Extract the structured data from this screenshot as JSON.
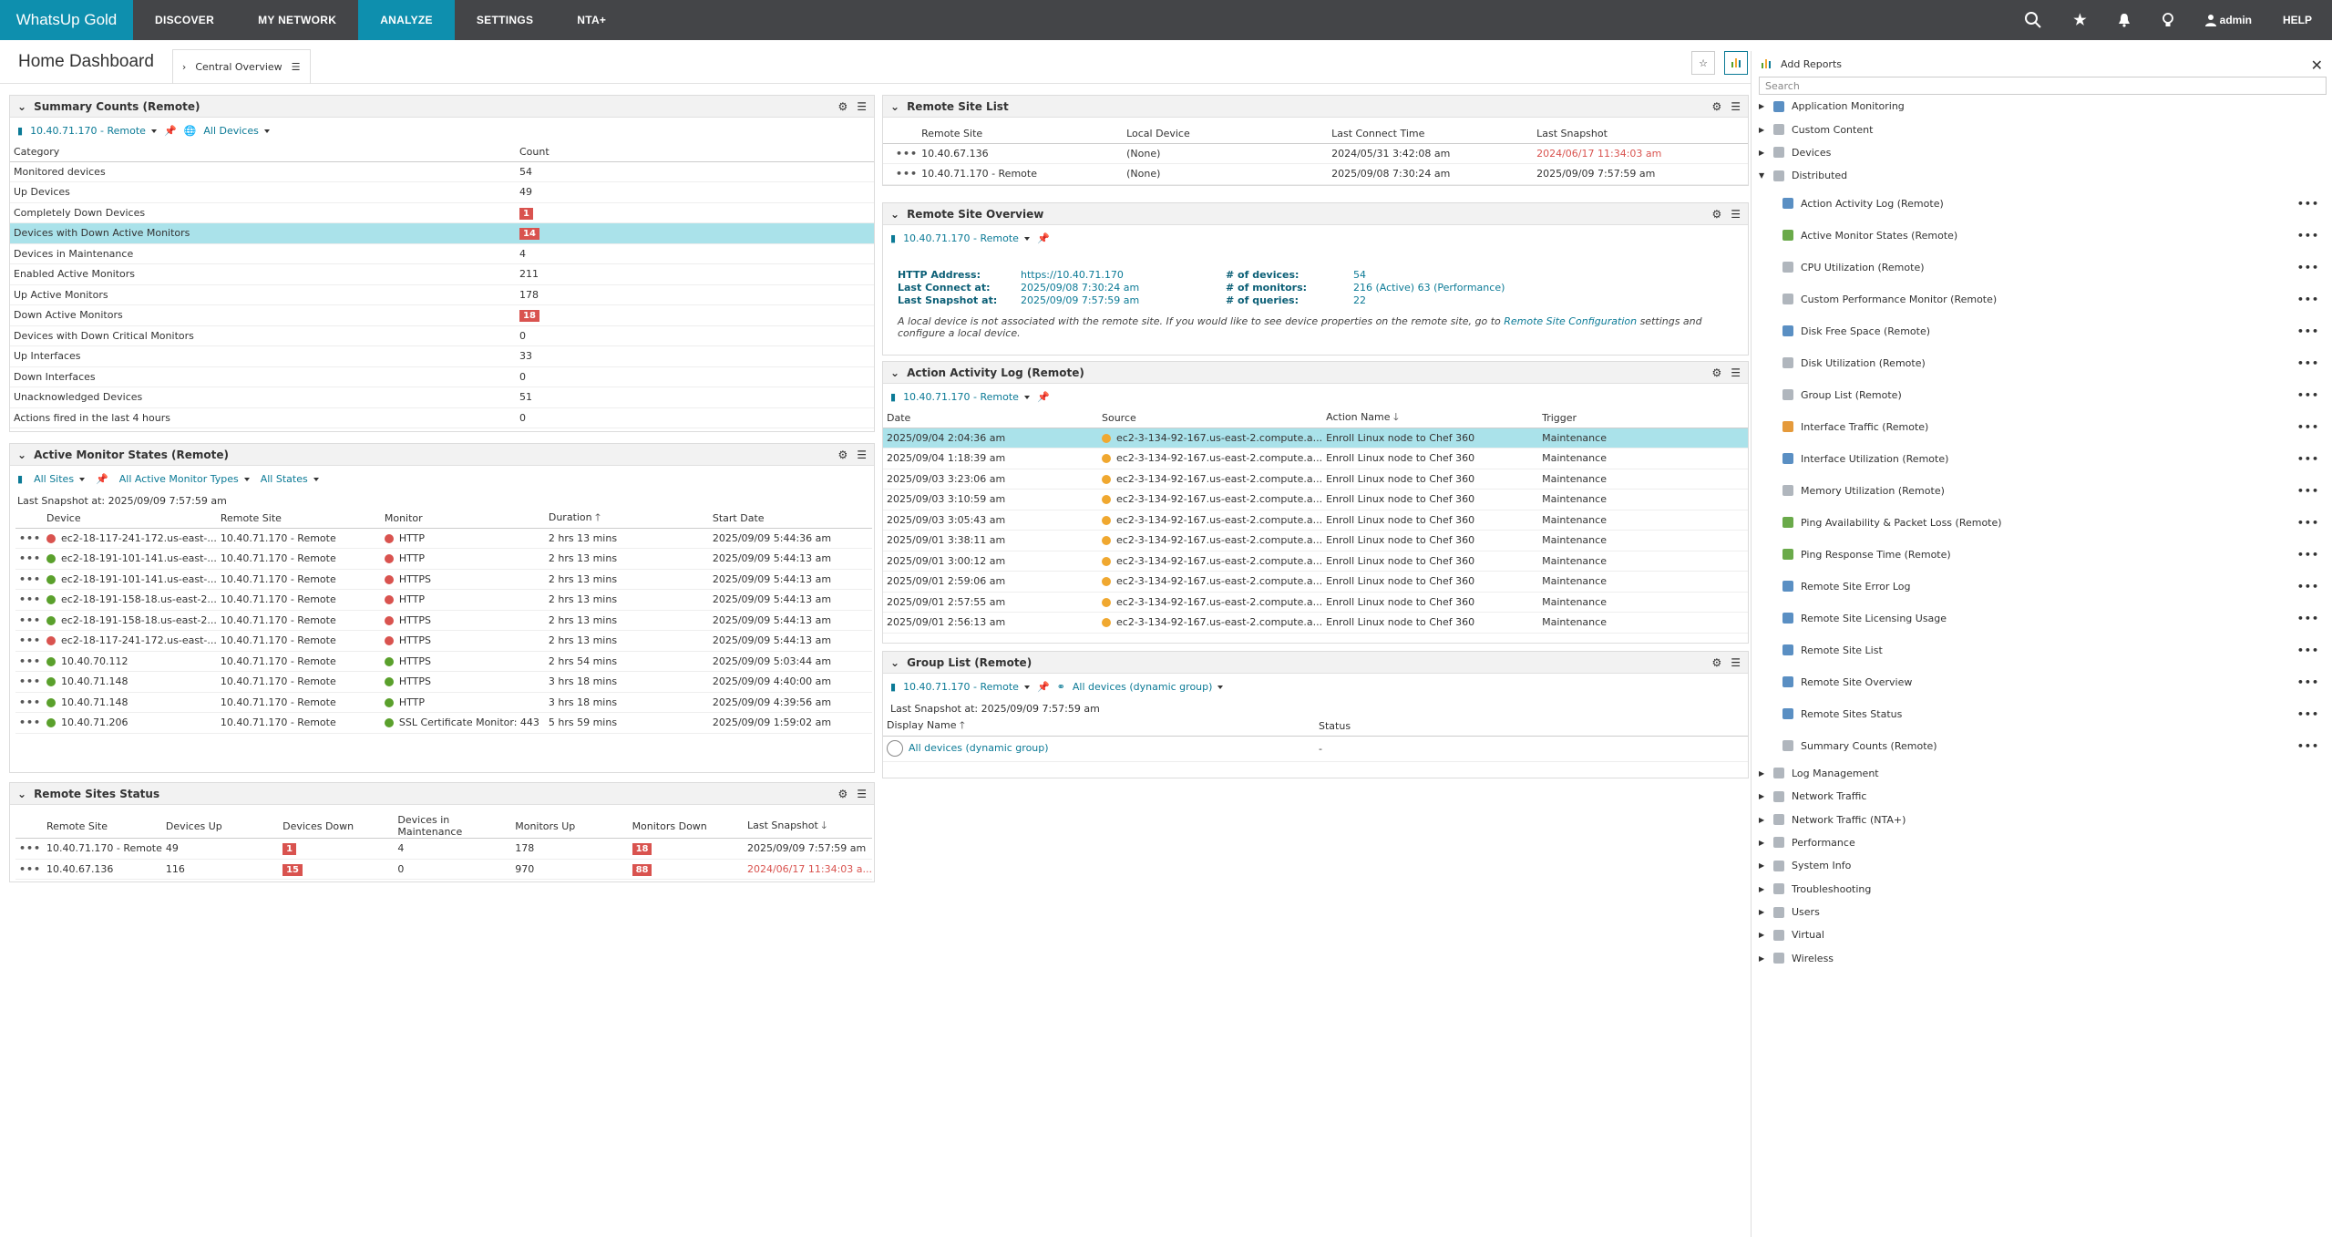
{
  "nav": {
    "logo": "WhatsUp Gold",
    "items": [
      "DISCOVER",
      "MY NETWORK",
      "ANALYZE",
      "SETTINGS",
      "NTA+"
    ],
    "active": "ANALYZE",
    "user": "admin",
    "help": "HELP"
  },
  "header": {
    "title": "Home Dashboard",
    "tab": "Central Overview"
  },
  "summary": {
    "title": "Summary Counts (Remote)",
    "site": "10.40.71.170 - Remote",
    "devices": "All Devices",
    "col_category": "Category",
    "col_count": "Count",
    "rows": [
      {
        "cat": "Monitored devices",
        "count": "54"
      },
      {
        "cat": "Up Devices",
        "count": "49"
      },
      {
        "cat": "Completely Down Devices",
        "count": "1"
      },
      {
        "cat": "Devices with Down Active Monitors",
        "count": "14"
      },
      {
        "cat": "Devices in Maintenance",
        "count": "4"
      },
      {
        "cat": "Enabled Active Monitors",
        "count": "211"
      },
      {
        "cat": "Up Active Monitors",
        "count": "178"
      },
      {
        "cat": "Down Active Monitors",
        "count": "18"
      },
      {
        "cat": "Devices with Down Critical Monitors",
        "count": "0"
      },
      {
        "cat": "Up Interfaces",
        "count": "33"
      },
      {
        "cat": "Down Interfaces",
        "count": "0"
      },
      {
        "cat": "Unacknowledged Devices",
        "count": "51"
      },
      {
        "cat": "Actions fired in the last 4 hours",
        "count": "0"
      }
    ]
  },
  "ams": {
    "title": "Active Monitor States (Remote)",
    "filter_sites": "All Sites",
    "filter_types": "All Active Monitor Types",
    "filter_states": "All States",
    "snapshot": "Last Snapshot at: 2025/09/09 7:57:59 am",
    "cols": [
      "Device",
      "Remote Site",
      "Monitor",
      "Duration",
      "Start Date"
    ],
    "rows": [
      {
        "device": "ec2-18-117-241-172.us-east-...",
        "site": "10.40.71.170 - Remote",
        "monitor": "HTTP",
        "duration": "2 hrs 13 mins",
        "start": "2025/09/09 5:44:36 am",
        "dev_state": "red",
        "mon_state": "red"
      },
      {
        "device": "ec2-18-191-101-141.us-east-...",
        "site": "10.40.71.170 - Remote",
        "monitor": "HTTP",
        "duration": "2 hrs 13 mins",
        "start": "2025/09/09 5:44:13 am",
        "dev_state": "green",
        "mon_state": "red"
      },
      {
        "device": "ec2-18-191-101-141.us-east-...",
        "site": "10.40.71.170 - Remote",
        "monitor": "HTTPS",
        "duration": "2 hrs 13 mins",
        "start": "2025/09/09 5:44:13 am",
        "dev_state": "green",
        "mon_state": "red"
      },
      {
        "device": "ec2-18-191-158-18.us-east-2...",
        "site": "10.40.71.170 - Remote",
        "monitor": "HTTP",
        "duration": "2 hrs 13 mins",
        "start": "2025/09/09 5:44:13 am",
        "dev_state": "green",
        "mon_state": "red"
      },
      {
        "device": "ec2-18-191-158-18.us-east-2...",
        "site": "10.40.71.170 - Remote",
        "monitor": "HTTPS",
        "duration": "2 hrs 13 mins",
        "start": "2025/09/09 5:44:13 am",
        "dev_state": "green",
        "mon_state": "red"
      },
      {
        "device": "ec2-18-117-241-172.us-east-...",
        "site": "10.40.71.170 - Remote",
        "monitor": "HTTPS",
        "duration": "2 hrs 13 mins",
        "start": "2025/09/09 5:44:13 am",
        "dev_state": "red",
        "mon_state": "red"
      },
      {
        "device": "10.40.70.112",
        "site": "10.40.71.170 - Remote",
        "monitor": "HTTPS",
        "duration": "2 hrs 54 mins",
        "start": "2025/09/09 5:03:44 am",
        "dev_state": "green",
        "mon_state": "green"
      },
      {
        "device": "10.40.71.148",
        "site": "10.40.71.170 - Remote",
        "monitor": "HTTPS",
        "duration": "3 hrs 18 mins",
        "start": "2025/09/09 4:40:00 am",
        "dev_state": "green",
        "mon_state": "green"
      },
      {
        "device": "10.40.71.148",
        "site": "10.40.71.170 - Remote",
        "monitor": "HTTP",
        "duration": "3 hrs 18 mins",
        "start": "2025/09/09 4:39:56 am",
        "dev_state": "green",
        "mon_state": "green"
      },
      {
        "device": "10.40.71.206",
        "site": "10.40.71.170 - Remote",
        "monitor": "SSL Certificate Monitor: 443",
        "duration": "5 hrs 59 mins",
        "start": "2025/09/09 1:59:02 am",
        "dev_state": "green",
        "mon_state": "green"
      }
    ]
  },
  "rss": {
    "title": "Remote Sites Status",
    "cols": [
      "Remote Site",
      "Devices Up",
      "Devices Down",
      "Devices in Maintenance",
      "Monitors Up",
      "Monitors Down",
      "Last Snapshot"
    ],
    "rows": [
      {
        "site": "10.40.71.170 - Remote",
        "up": "49",
        "down": "1",
        "maint": "4",
        "mup": "178",
        "mdown": "18",
        "snap": "2025/09/09 7:57:59 am"
      },
      {
        "site": "10.40.67.136",
        "up": "116",
        "down": "15",
        "maint": "0",
        "mup": "970",
        "mdown": "88",
        "snap": "2024/06/17 11:34:03 a..."
      }
    ]
  },
  "rsl": {
    "title": "Remote Site List",
    "cols": [
      "Remote Site",
      "Local Device",
      "Last Connect Time",
      "Last Snapshot"
    ],
    "rows": [
      {
        "site": "10.40.67.136",
        "local": "(None)",
        "connect": "2024/05/31 3:42:08 am",
        "snap": "2024/06/17 11:34:03 am"
      },
      {
        "site": "10.40.71.170 - Remote",
        "local": "(None)",
        "connect": "2025/09/08 7:30:24 am",
        "snap": "2025/09/09 7:57:59 am"
      }
    ]
  },
  "rso": {
    "title": "Remote Site Overview",
    "site": "10.40.71.170 - Remote",
    "http_label": "HTTP Address:",
    "http_value": "https://10.40.71.170",
    "connect_label": "Last Connect at:",
    "connect_value": "2025/09/08 7:30:24 am",
    "snap_label": "Last Snapshot at:",
    "snap_value": "2025/09/09 7:57:59 am",
    "devices_label": "# of devices:",
    "devices_value": "54",
    "monitors_label": "# of monitors:",
    "monitors_value": "216 (Active)  63 (Performance)",
    "queries_label": "# of queries:",
    "queries_value": "22",
    "note_a": "A local device is not associated with the remote site. If you would like to see device properties on the remote site, go to ",
    "note_link": "Remote Site Configuration",
    "note_b": " settings and configure a local device."
  },
  "aal": {
    "title": "Action Activity Log (Remote)",
    "site": "10.40.71.170 - Remote",
    "cols": [
      "Date",
      "Source",
      "Action Name",
      "Trigger"
    ],
    "rows": [
      {
        "date": "2025/09/04 2:04:36 am",
        "source": "ec2-3-134-92-167.us-east-2.compute.a...",
        "action": "Enroll Linux node to Chef 360",
        "trigger": "Maintenance"
      },
      {
        "date": "2025/09/04 1:18:39 am",
        "source": "ec2-3-134-92-167.us-east-2.compute.a...",
        "action": "Enroll Linux node to Chef 360",
        "trigger": "Maintenance"
      },
      {
        "date": "2025/09/03 3:23:06 am",
        "source": "ec2-3-134-92-167.us-east-2.compute.a...",
        "action": "Enroll Linux node to Chef 360",
        "trigger": "Maintenance"
      },
      {
        "date": "2025/09/03 3:10:59 am",
        "source": "ec2-3-134-92-167.us-east-2.compute.a...",
        "action": "Enroll Linux node to Chef 360",
        "trigger": "Maintenance"
      },
      {
        "date": "2025/09/03 3:05:43 am",
        "source": "ec2-3-134-92-167.us-east-2.compute.a...",
        "action": "Enroll Linux node to Chef 360",
        "trigger": "Maintenance"
      },
      {
        "date": "2025/09/01 3:38:11 am",
        "source": "ec2-3-134-92-167.us-east-2.compute.a...",
        "action": "Enroll Linux node to Chef 360",
        "trigger": "Maintenance"
      },
      {
        "date": "2025/09/01 3:00:12 am",
        "source": "ec2-3-134-92-167.us-east-2.compute.a...",
        "action": "Enroll Linux node to Chef 360",
        "trigger": "Maintenance"
      },
      {
        "date": "2025/09/01 2:59:06 am",
        "source": "ec2-3-134-92-167.us-east-2.compute.a...",
        "action": "Enroll Linux node to Chef 360",
        "trigger": "Maintenance"
      },
      {
        "date": "2025/09/01 2:57:55 am",
        "source": "ec2-3-134-92-167.us-east-2.compute.a...",
        "action": "Enroll Linux node to Chef 360",
        "trigger": "Maintenance"
      },
      {
        "date": "2025/09/01 2:56:13 am",
        "source": "ec2-3-134-92-167.us-east-2.compute.a...",
        "action": "Enroll Linux node to Chef 360",
        "trigger": "Maintenance"
      }
    ]
  },
  "gl": {
    "title": "Group List (Remote)",
    "site": "10.40.71.170 - Remote",
    "group": "All devices (dynamic group)",
    "snapshot": "Last Snapshot at: 2025/09/09 7:57:59 am",
    "col_name": "Display Name",
    "col_status": "Status",
    "row_name": "All devices (dynamic group)",
    "row_status": "-"
  },
  "reports": {
    "title": "Add Reports",
    "search_placeholder": "Search",
    "top": [
      "Application Monitoring",
      "Custom Content",
      "Devices",
      "Distributed"
    ],
    "distributed": [
      "Action Activity Log (Remote)",
      "Active Monitor States (Remote)",
      "CPU Utilization (Remote)",
      "Custom Performance Monitor (Remote)",
      "Disk Free Space (Remote)",
      "Disk Utilization (Remote)",
      "Group List (Remote)",
      "Interface Traffic (Remote)",
      "Interface Utilization (Remote)",
      "Memory Utilization (Remote)",
      "Ping Availability & Packet Loss (Remote)",
      "Ping Response Time (Remote)",
      "Remote Site Error Log",
      "Remote Site Licensing Usage",
      "Remote Site List",
      "Remote Site Overview",
      "Remote Sites Status",
      "Summary Counts (Remote)"
    ],
    "bottom": [
      "Log Management",
      "Network Traffic",
      "Network Traffic (NTA+)",
      "Performance",
      "System Info",
      "Troubleshooting",
      "Users",
      "Virtual",
      "Wireless"
    ]
  }
}
